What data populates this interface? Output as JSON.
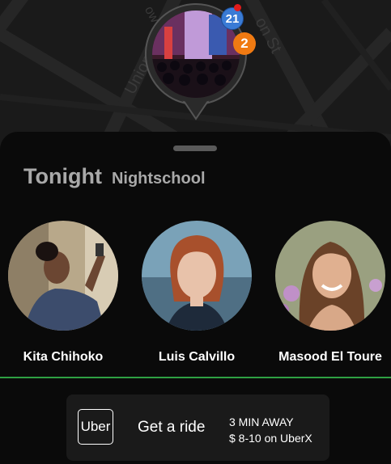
{
  "map": {
    "streets": [
      "Union",
      "on St",
      "ow"
    ]
  },
  "pin": {
    "badge_primary": "21",
    "badge_secondary": "2",
    "photo_icon": "crowd-event-photo"
  },
  "sheet": {
    "title": "Tonight",
    "venue": "Nightschool"
  },
  "people": [
    {
      "name": "Kita Chihoko"
    },
    {
      "name": "Luis Calvillo"
    },
    {
      "name": "Masood El Toure"
    }
  ],
  "uber": {
    "logo_text": "Uber",
    "cta": "Get a ride",
    "eta": "3 MIN AWAY",
    "price": "$ 8-10 on UberX"
  },
  "colors": {
    "accent_green": "#2ea043",
    "badge_blue": "#3a7bd5",
    "badge_orange": "#f07a12"
  }
}
